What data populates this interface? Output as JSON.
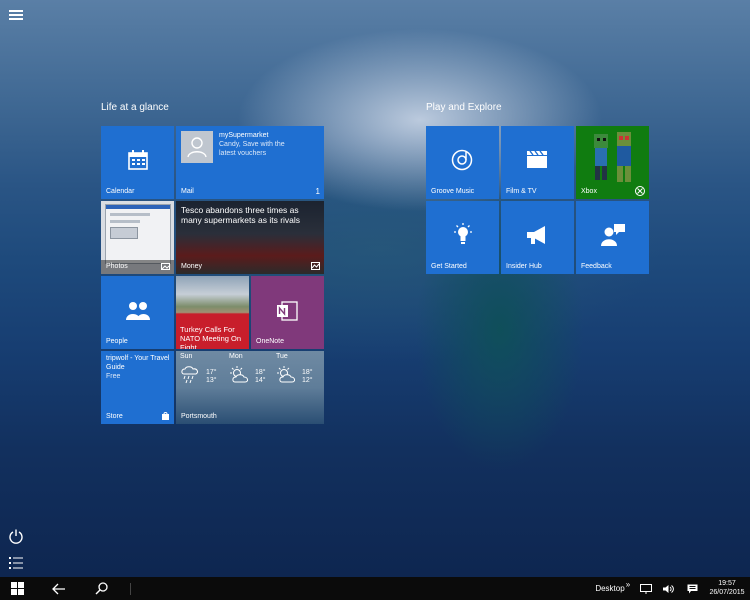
{
  "groups": {
    "left_title": "Life at a glance",
    "right_title": "Play and Explore"
  },
  "tiles": {
    "calendar": {
      "label": "Calendar"
    },
    "mail": {
      "label": "Mail",
      "from": "mySupermarket",
      "body": "Candy, Save with the latest vouchers",
      "count": "1"
    },
    "photos": {
      "label": "Photos"
    },
    "money": {
      "label": "Money",
      "headline": "Tesco abandons three times as many supermarkets as its rivals"
    },
    "people": {
      "label": "People"
    },
    "news": {
      "headline": "Turkey Calls For NATO Meeting On Fight..."
    },
    "onenote": {
      "label": "OneNote"
    },
    "store": {
      "label": "Store",
      "app": "tripwolf - Your Travel Guide",
      "price": "Free"
    },
    "weather": {
      "label": "Portsmouth",
      "days": [
        {
          "day": "Sun",
          "high": "17°",
          "low": "13°"
        },
        {
          "day": "Mon",
          "high": "18°",
          "low": "14°"
        },
        {
          "day": "Tue",
          "high": "18°",
          "low": "12°"
        }
      ]
    },
    "groove": {
      "label": "Groove Music"
    },
    "film": {
      "label": "Film & TV"
    },
    "xbox": {
      "label": "Xbox"
    },
    "get_started": {
      "label": "Get Started"
    },
    "insider": {
      "label": "Insider Hub"
    },
    "feedback": {
      "label": "Feedback"
    }
  },
  "taskbar": {
    "desktop_label": "Desktop",
    "chevron": "»",
    "time": "19:57",
    "date": "26/07/2015"
  },
  "colors": {
    "tile_blue": "#1f6fd1",
    "onenote_purple": "#80397b",
    "news_red": "#c81e2b",
    "xbox_green": "#107c10"
  }
}
